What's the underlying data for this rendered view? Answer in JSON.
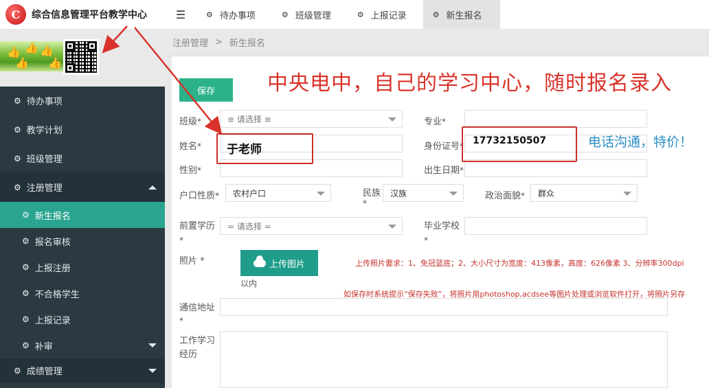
{
  "app": {
    "logo_letter": "C",
    "title": "综合信息管理平台教学中心"
  },
  "tabs": [
    {
      "label": "待办事项",
      "active": false
    },
    {
      "label": "班级管理",
      "active": false
    },
    {
      "label": "上报记录",
      "active": false
    },
    {
      "label": "新生报名",
      "active": true
    }
  ],
  "sidebar": {
    "items": [
      {
        "label": "待办事项"
      },
      {
        "label": "教学计划"
      },
      {
        "label": "班级管理"
      }
    ],
    "group_registration": {
      "label": "注册管理",
      "children": [
        {
          "label": "新生报名",
          "active": true
        },
        {
          "label": "报名审核"
        },
        {
          "label": "上报注册"
        },
        {
          "label": "不合格学生"
        },
        {
          "label": "上报记录"
        },
        {
          "label": "补审"
        }
      ]
    },
    "group_grades": {
      "label": "成绩管理"
    }
  },
  "breadcrumb": {
    "parent": "注册管理",
    "separator": ">",
    "current": "新生报名"
  },
  "form": {
    "save_label": "保存",
    "class_label": "班级",
    "class_value": "≡ 请选择 ≡",
    "major_label": "专业",
    "name_label": "姓名",
    "id_label": "身份证号",
    "gender_label": "性别",
    "birth_label": "出生日期",
    "hukou_label": "户口性质",
    "hukou_value": "农村户口",
    "ethnic_label": "民族",
    "ethnic_value": "汉族",
    "political_label": "政治面貌",
    "political_value": "群众",
    "edu_label": "前置学历",
    "edu_value": "= 请选择 =",
    "school_label": "毕业学校",
    "photo_label": "照片 *",
    "upload_label": "上传图片",
    "photo_note": "上传照片要求：1、免冠蓝底；2、大小尺寸为宽度：413像素，高度：626像素 3、分辨率300dpi",
    "photo_note_tail": "以内",
    "save_fail_note": "如保存时系统提示“保存失败”，将照片用photoshop,acdsee等图片处理或浏览软件打开，将照片另存",
    "address_label": "通信地址",
    "work_label_1": "工作学习",
    "work_label_2": "经历",
    "required_mark": "*"
  },
  "overlay": {
    "headline": "中央电中，自己的学习中心，随时报名录入",
    "teacher": "于老师",
    "phone": "17732150507",
    "promo": "电话沟通，特价！"
  }
}
